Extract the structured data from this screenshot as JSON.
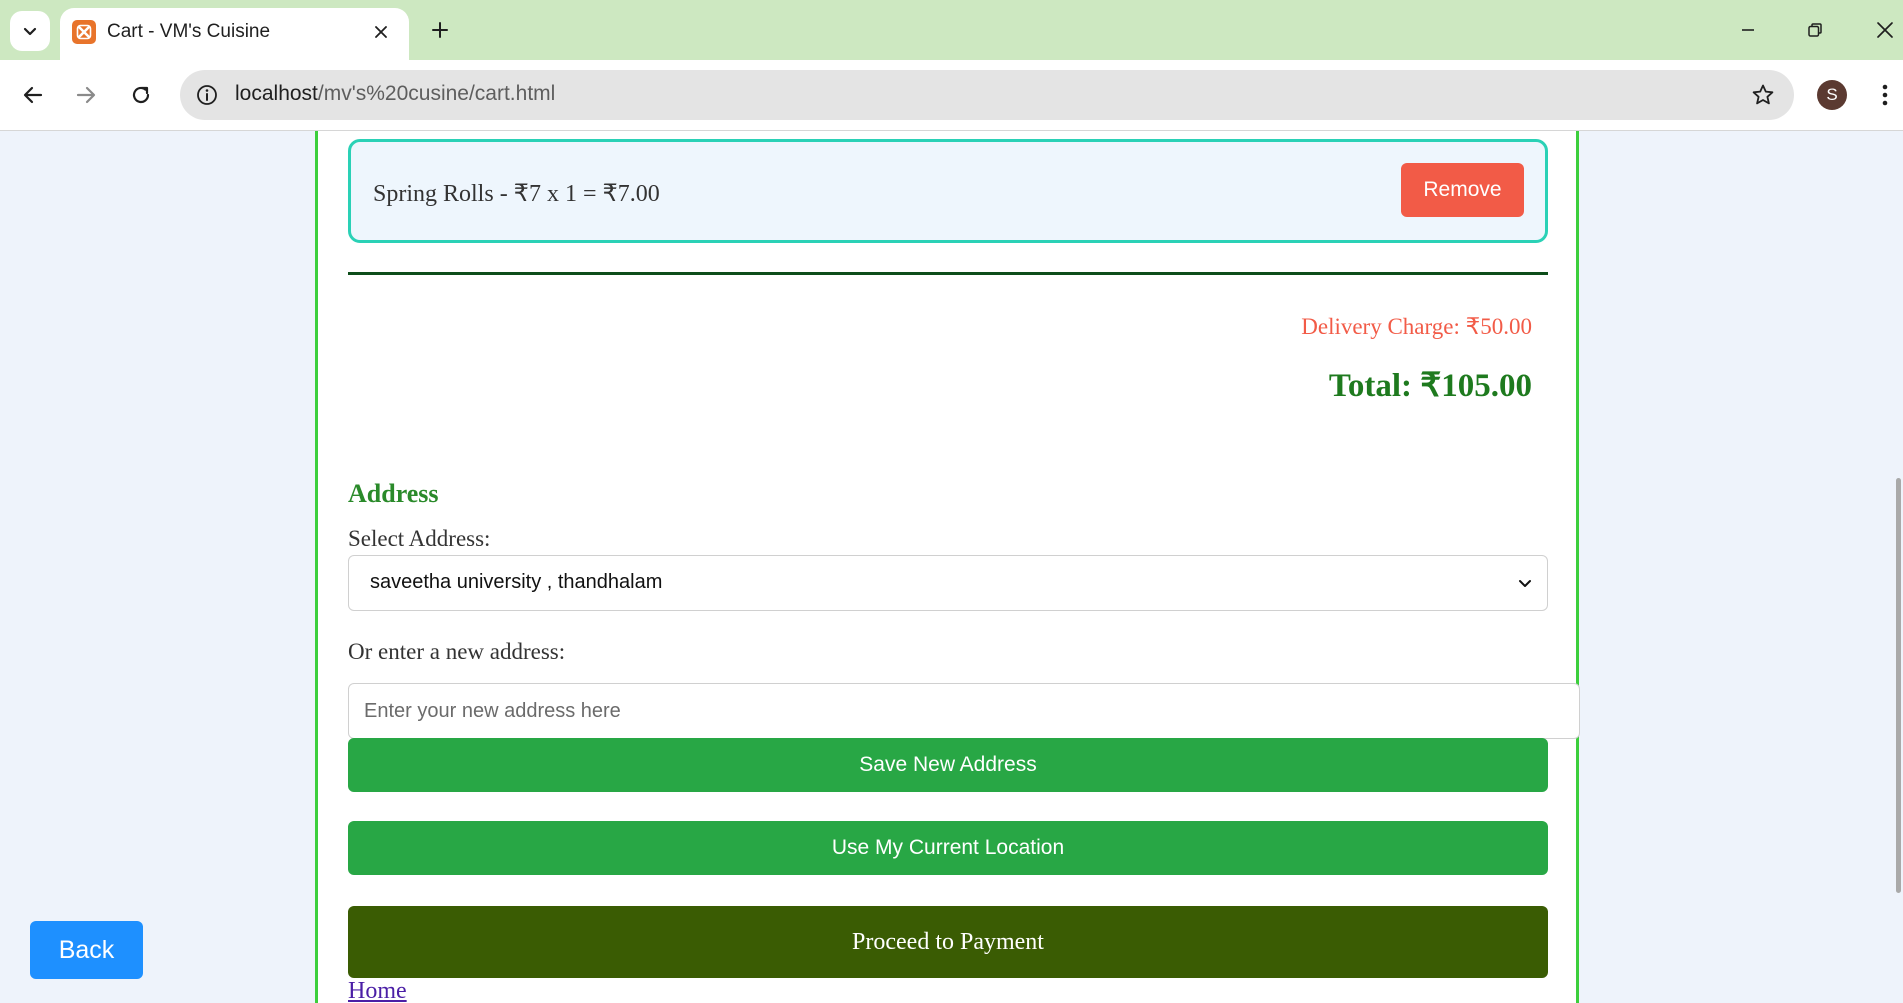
{
  "browser": {
    "tab_title": "Cart - VM's Cuisine",
    "url_host": "localhost",
    "url_path": "/mv's%20cusine/cart.html",
    "profile_initial": "S"
  },
  "cart": {
    "items": [
      {
        "text": "Spring Rolls - ₹7 x 1 = ₹7.00",
        "remove_label": "Remove"
      }
    ],
    "delivery_charge": "Delivery Charge: ₹50.00",
    "total": "Total: ₹105.00"
  },
  "address": {
    "heading": "Address",
    "select_label": "Select Address:",
    "selected_value": "saveetha university , thandhalam",
    "new_label": "Or enter a new address:",
    "new_placeholder": "Enter your new address here",
    "save_label": "Save New Address",
    "location_label": "Use My Current Location"
  },
  "actions": {
    "proceed_label": "Proceed to Payment",
    "home_label": "Home",
    "back_label": "Back"
  },
  "colors": {
    "tabbar_bg": "#cde8c1",
    "container_border": "#3ccf3c",
    "item_border": "#2ad1b6",
    "remove_bg": "#f25b47",
    "delivery_text": "#f25b47",
    "total_text": "#1e7a1e",
    "green_button": "#28a745",
    "proceed_button": "#3a5c03",
    "back_button": "#1e90ff"
  },
  "icons": {
    "tab_menu": "chevron-down-icon",
    "favicon": "xampp-icon",
    "tab_close": "close-icon",
    "new_tab": "plus-icon",
    "minimize": "minimize-icon",
    "restore": "restore-icon",
    "close_window": "close-icon",
    "back": "arrow-left-icon",
    "forward": "arrow-right-icon",
    "reload": "reload-icon",
    "site_info": "info-icon",
    "bookmark": "star-icon",
    "browser_menu": "kebab-menu-icon",
    "select_chevron": "chevron-down-icon"
  }
}
